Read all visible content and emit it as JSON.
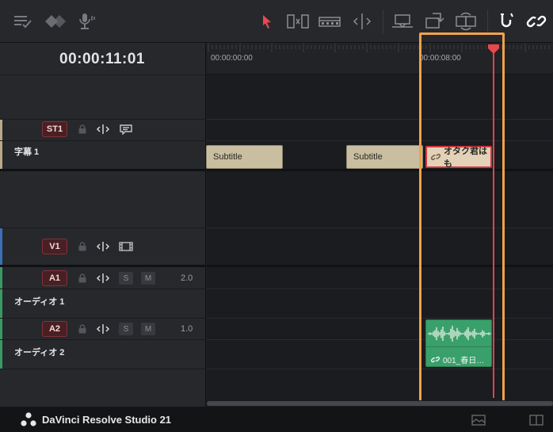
{
  "toolbar": {
    "left_icons": [
      "track-options-icon",
      "diamond-marker-icon",
      "microphone-icon"
    ],
    "tools": [
      "selection-arrow-icon",
      "trim-edit-icon",
      "dynamic-trim-icon",
      "blade-edit-icon",
      "insert-clip-icon",
      "overwrite-clip-icon",
      "replace-clip-icon",
      "snapping-icon",
      "linked-selection-icon"
    ],
    "accent_color": "#e84a4f"
  },
  "header": {
    "timecode": "00:00:11:01"
  },
  "ruler": {
    "labels": [
      "00:00:00:00",
      "00:00:08:00"
    ]
  },
  "tracks": {
    "st1": {
      "badge": "ST1",
      "name": "字幕 1"
    },
    "v1": {
      "badge": "V1"
    },
    "a1": {
      "badge": "A1",
      "name": "オーディオ 1",
      "solo": "S",
      "mute": "M",
      "volume": "2.0"
    },
    "a2": {
      "badge": "A2",
      "name": "オーディオ 2",
      "solo": "S",
      "mute": "M",
      "volume": "1.0"
    }
  },
  "clips": {
    "subtitle_1": "Subtitle",
    "subtitle_2": "Subtitle",
    "subtitle_3": "オタク君はも",
    "audio": "001_春日…"
  },
  "statusbar": {
    "app_name": "DaVinci Resolve Studio 21"
  },
  "colors": {
    "subtitle_clip": "#c9bfa0",
    "audio_clip": "#3aa06b",
    "playhead": "#d7474a",
    "highlight": "#f0a24a",
    "track_badge": "#4a1f23"
  }
}
